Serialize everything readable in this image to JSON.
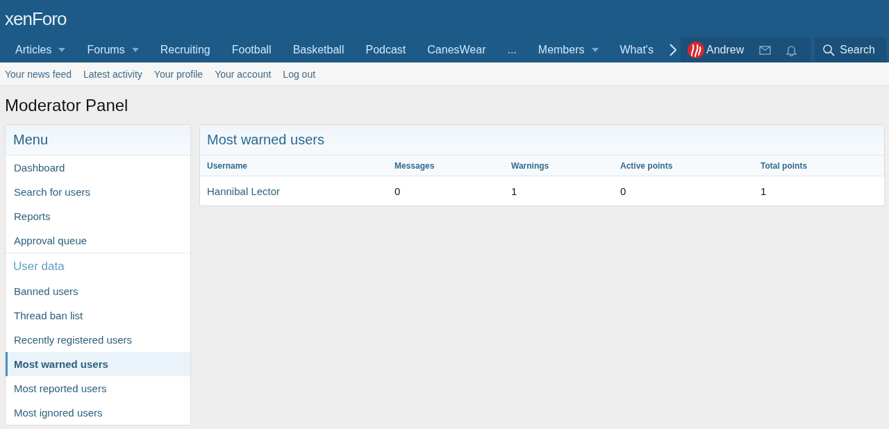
{
  "logo": "xenForo",
  "nav": [
    {
      "label": "Articles",
      "has_menu": true
    },
    {
      "label": "Forums",
      "has_menu": true
    },
    {
      "label": "Recruiting",
      "has_menu": false
    },
    {
      "label": "Football",
      "has_menu": false
    },
    {
      "label": "Basketball",
      "has_menu": false
    },
    {
      "label": "Podcast",
      "has_menu": false
    },
    {
      "label": "CanesWear",
      "has_menu": false
    },
    {
      "label": "...",
      "has_menu": false
    },
    {
      "label": "Members",
      "has_menu": true
    },
    {
      "label": "What's",
      "has_menu": false
    }
  ],
  "user": {
    "name": "Andrew"
  },
  "search": {
    "label": "Search"
  },
  "subnav": [
    "Your news feed",
    "Latest activity",
    "Your profile",
    "Your account",
    "Log out"
  ],
  "page_title": "Moderator Panel",
  "sidebar": {
    "sections": [
      {
        "title": "Menu",
        "kind": "block-header",
        "items": [
          {
            "label": "Dashboard",
            "selected": false
          },
          {
            "label": "Search for users",
            "selected": false
          },
          {
            "label": "Reports",
            "selected": false
          },
          {
            "label": "Approval queue",
            "selected": false
          }
        ]
      },
      {
        "title": "User data",
        "kind": "subheader",
        "items": [
          {
            "label": "Banned users",
            "selected": false
          },
          {
            "label": "Thread ban list",
            "selected": false
          },
          {
            "label": "Recently registered users",
            "selected": false
          },
          {
            "label": "Most warned users",
            "selected": true
          },
          {
            "label": "Most reported users",
            "selected": false
          },
          {
            "label": "Most ignored users",
            "selected": false
          }
        ]
      }
    ]
  },
  "panel": {
    "title": "Most warned users",
    "table": {
      "columns": [
        "Username",
        "Messages",
        "Warnings",
        "Active points",
        "Total points"
      ],
      "rows": [
        [
          "Hannibal Lector",
          "0",
          "1",
          "0",
          "1"
        ]
      ]
    }
  }
}
